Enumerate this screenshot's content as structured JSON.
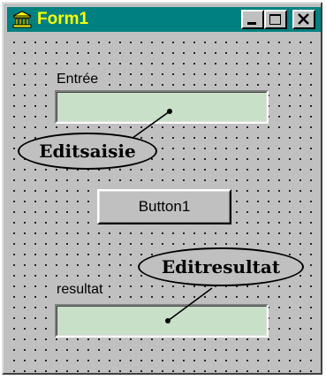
{
  "window": {
    "title": "Form1"
  },
  "fields": {
    "input_label": "Entrée",
    "input_value": "",
    "result_label": "resultat",
    "result_value": ""
  },
  "button": {
    "label": "Button1"
  },
  "callouts": {
    "input_name": "Editsaisie",
    "result_name": "Editresultat"
  },
  "colors": {
    "titlebar": "#008080",
    "title_text": "#ffff00",
    "form_face": "#c0c0c0",
    "edit_background": "#c8e0c8"
  },
  "icons": {
    "app": "columns-building-icon",
    "minimize": "minimize-icon",
    "maximize": "maximize-icon",
    "close": "close-icon"
  }
}
